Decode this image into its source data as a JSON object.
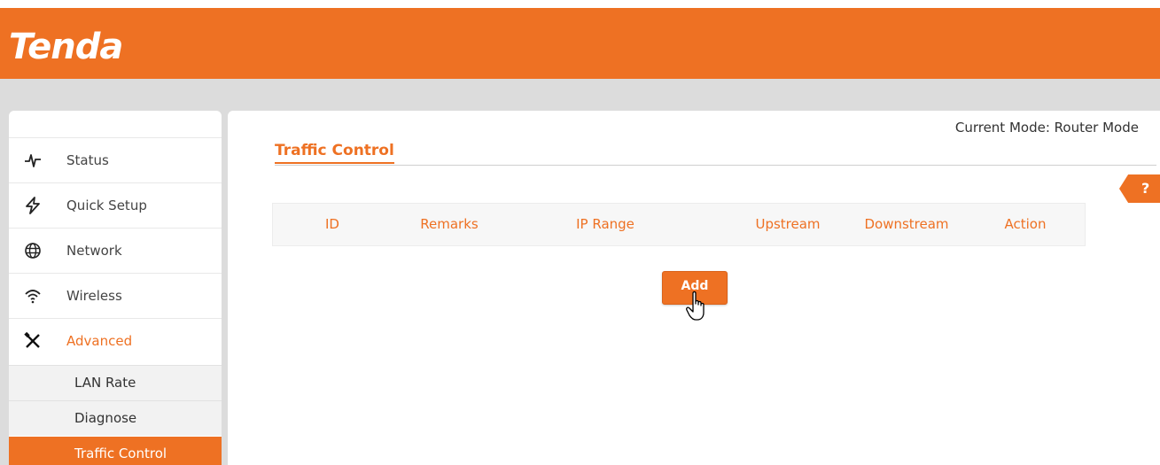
{
  "header": {
    "logo_text": "Tenda",
    "brand_color": "#ee7123"
  },
  "sidebar": {
    "items": [
      {
        "label": "Status",
        "icon": "status-pulse-icon"
      },
      {
        "label": "Quick Setup",
        "icon": "quick-setup-bolt-icon"
      },
      {
        "label": "Network",
        "icon": "globe-icon"
      },
      {
        "label": "Wireless",
        "icon": "wifi-icon"
      },
      {
        "label": "Advanced",
        "icon": "tools-icon",
        "active": true
      }
    ],
    "sub_items": [
      {
        "label": "LAN Rate"
      },
      {
        "label": "Diagnose"
      },
      {
        "label": "Traffic Control",
        "selected": true
      }
    ]
  },
  "main": {
    "current_mode": "Current Mode: Router Mode",
    "page_title": "Traffic Control",
    "help_label": "?",
    "table": {
      "columns": [
        "ID",
        "Remarks",
        "IP Range",
        "Upstream",
        "Downstream",
        "Action"
      ]
    },
    "add_button_label": "Add"
  }
}
